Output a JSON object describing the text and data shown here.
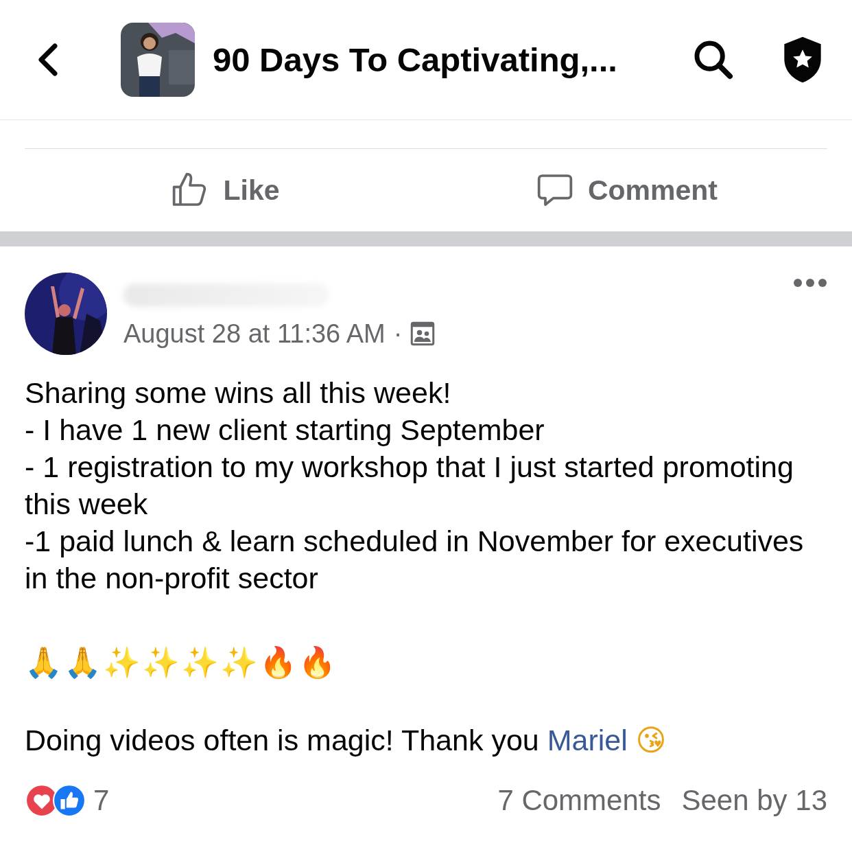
{
  "header": {
    "title": "90 Days To Captivating,..."
  },
  "actions": [
    {
      "kind": "like",
      "label": "Like"
    },
    {
      "kind": "comment",
      "label": "Comment"
    }
  ],
  "post": {
    "timestamp": "August 28 at 11:36 AM",
    "separator": "·",
    "body": [
      "Sharing some wins all this week!",
      "- I have 1 new client starting September",
      "- 1 registration to my workshop that I just started promoting this week",
      "-1 paid lunch & learn scheduled in November for executives in the non-profit sector"
    ],
    "emojis": "🙏🙏✨✨✨✨🔥🔥",
    "message": {
      "text": "Doing videos often is magic!  Thank you",
      "mention": "Mariel",
      "emoji": "😘"
    },
    "reactions": {
      "count": "7"
    },
    "comments": "7 Comments",
    "seen": "Seen by 13"
  }
}
